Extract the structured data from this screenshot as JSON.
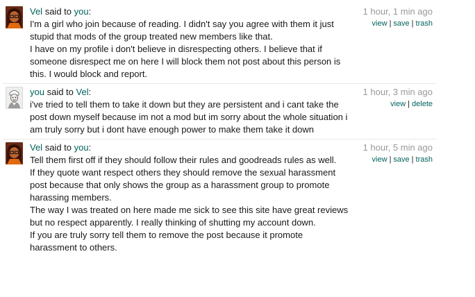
{
  "messages": [
    {
      "author": "Vel",
      "said": "said to",
      "recipient": "you",
      "colon": ":",
      "time": "1 hour, 1 min ago",
      "actions": [
        "view",
        "save",
        "trash"
      ],
      "avatar": "vel-avatar",
      "paragraphs": [
        "I'm a girl who join because of reading. I didn't say you agree with them it just stupid that mods of the group treated new members like that.",
        "I have on my profile i don't believe in disrespecting others. I believe that if someone disrespect me on here I will block them not post about this person is this. I would block and report."
      ]
    },
    {
      "author": "you",
      "said": "said to",
      "recipient": "Vel",
      "colon": ":",
      "time": "1 hour, 3 min ago",
      "actions": [
        "view",
        "delete"
      ],
      "avatar": "you-avatar",
      "paragraphs": [
        "i've tried to tell them to take it down but they are persistent and i cant take the post down myself because im not a mod but im sorry about the whole situation i am truly sorry but i dont have enough power to make them take it down"
      ]
    },
    {
      "author": "Vel",
      "said": "said to",
      "recipient": "you",
      "colon": ":",
      "time": "1 hour, 5 min ago",
      "actions": [
        "view",
        "save",
        "trash"
      ],
      "avatar": "vel-avatar",
      "paragraphs": [
        "Tell them first off if they should follow their rules and goodreads rules as well.",
        "If they quote want respect others they should remove the sexual harassment post because that only shows the group as a harassment group to promote harassing members.",
        "The way I was treated on here made me sick to see this site have great reviews but no respect apparently. I really thinking of shutting my account down.",
        "If you are truly sorry tell them to remove the post because it promote harassment to others."
      ]
    }
  ]
}
